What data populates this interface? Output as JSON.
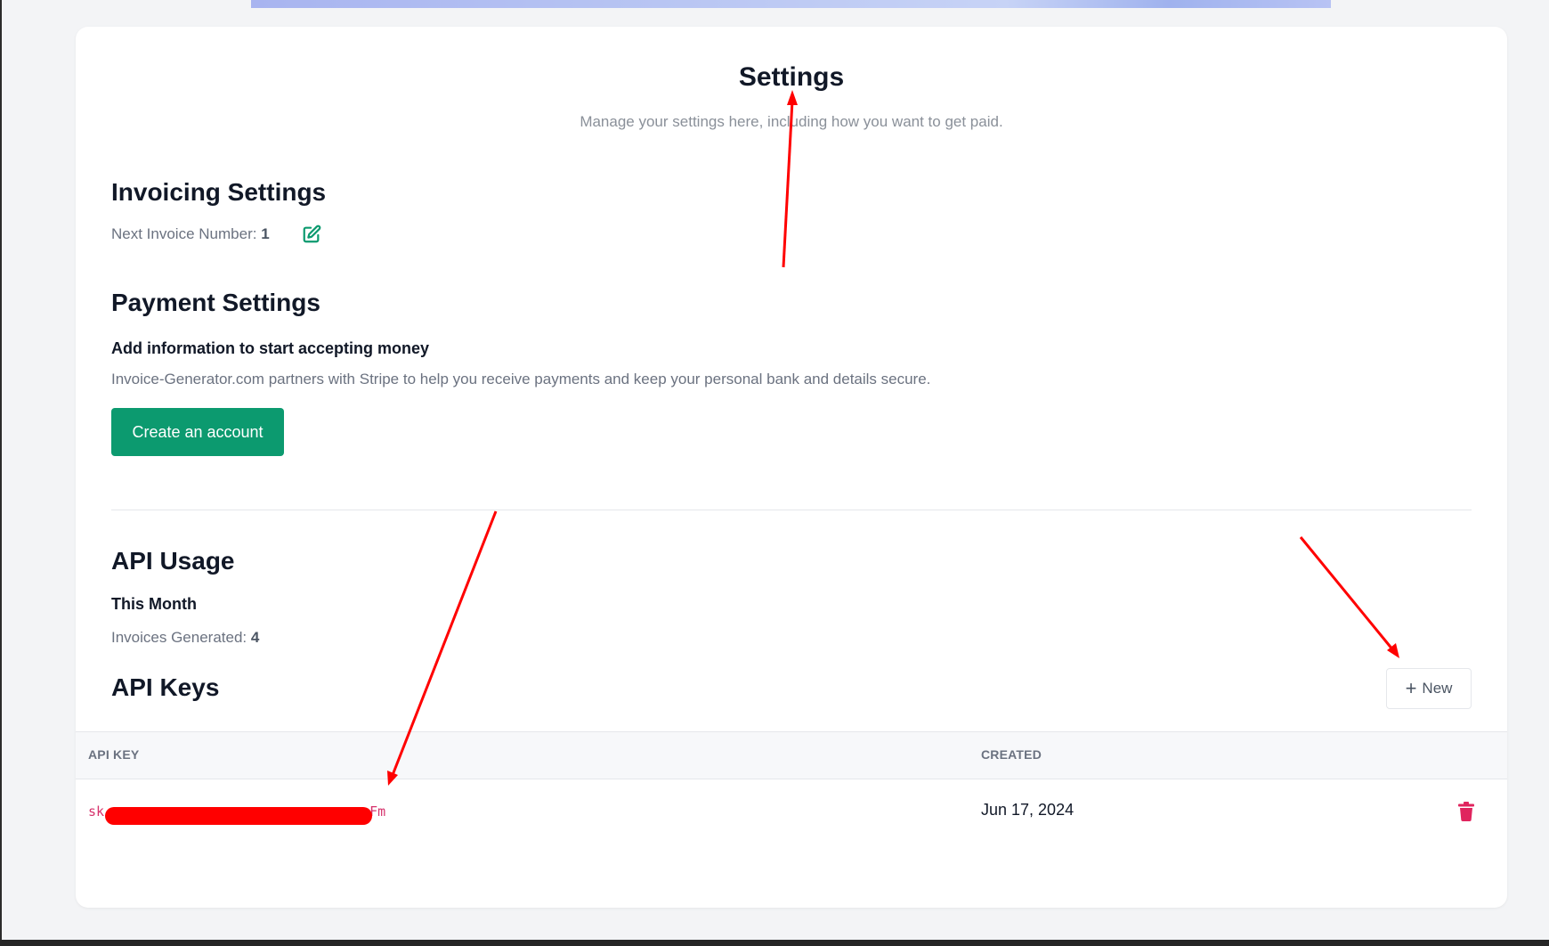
{
  "header": {
    "title": "Settings",
    "subtitle": "Manage your settings here, including how you want to get paid."
  },
  "invoicing": {
    "title": "Invoicing Settings",
    "next_label": "Next Invoice Number:",
    "next_value": "1",
    "edit_icon": "edit-icon"
  },
  "payment": {
    "title": "Payment Settings",
    "heading": "Add information to start accepting money",
    "description": "Invoice-Generator.com partners with Stripe to help you receive payments and keep your personal bank and details secure.",
    "button_label": "Create an account"
  },
  "usage": {
    "title": "API Usage",
    "period": "This Month",
    "generated_label": "Invoices Generated:",
    "generated_value": "4"
  },
  "api_keys": {
    "title": "API Keys",
    "new_button_label": "New",
    "columns": [
      "API KEY",
      "CREATED"
    ],
    "rows": [
      {
        "key_prefix": "sk",
        "key_suffix": "Fm",
        "created": "Jun 17, 2024",
        "delete_icon": "trash-icon"
      }
    ]
  },
  "colors": {
    "accent": "#0c9a6f",
    "danger": "#e0245e",
    "annotation": "#ff0000"
  }
}
